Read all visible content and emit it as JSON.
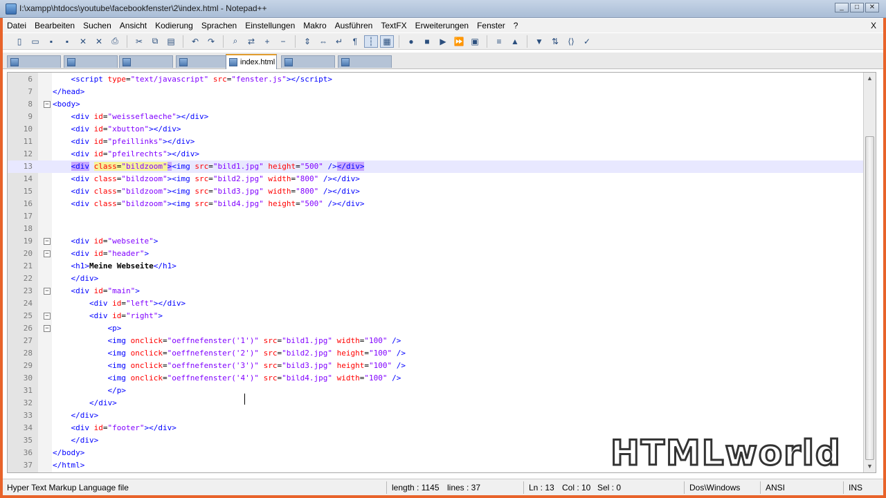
{
  "window": {
    "title": "I:\\xampp\\htdocs\\youtube\\facebookfenster\\2\\index.html - Notepad++"
  },
  "menu": [
    "Datei",
    "Bearbeiten",
    "Suchen",
    "Ansicht",
    "Kodierung",
    "Sprachen",
    "Einstellungen",
    "Makro",
    "Ausführen",
    "TextFX",
    "Erweiterungen",
    "Fenster",
    "?"
  ],
  "menu_close": "X",
  "window_controls": {
    "minimize": "_",
    "maximize": "□",
    "close": "✕"
  },
  "tabs": [
    {
      "label": "",
      "active": false
    },
    {
      "label": "",
      "active": false
    },
    {
      "label": "",
      "active": false
    },
    {
      "label": "",
      "active": false
    },
    {
      "label": "index.html",
      "active": true
    },
    {
      "label": "",
      "active": false
    },
    {
      "label": "",
      "active": false
    }
  ],
  "editor": {
    "current_line": 13,
    "lines": [
      {
        "n": "6",
        "fold": "",
        "html": "    <span class=\"tag\">&lt;script</span> <span class=\"attr\">type</span>=<span class=\"val\">\"text/javascript\"</span> <span class=\"attr\">src</span>=<span class=\"val\">\"fenster.js\"</span><span class=\"tag\">&gt;&lt;/script&gt;</span>"
      },
      {
        "n": "7",
        "fold": "",
        "html": "<span class=\"tag\">&lt;/head&gt;</span>"
      },
      {
        "n": "8",
        "fold": "−",
        "html": "<span class=\"tag\">&lt;body&gt;</span>"
      },
      {
        "n": "9",
        "fold": "",
        "html": "    <span class=\"tag\">&lt;div</span> <span class=\"attr\">id</span>=<span class=\"val\">\"weisseflaeche\"</span><span class=\"tag\">&gt;&lt;/div&gt;</span>"
      },
      {
        "n": "10",
        "fold": "",
        "html": "    <span class=\"tag\">&lt;div</span> <span class=\"attr\">id</span>=<span class=\"val\">\"xbutton\"</span><span class=\"tag\">&gt;&lt;/div&gt;</span>"
      },
      {
        "n": "11",
        "fold": "",
        "html": "    <span class=\"tag\">&lt;div</span> <span class=\"attr\">id</span>=<span class=\"val\">\"pfeillinks\"</span><span class=\"tag\">&gt;&lt;/div&gt;</span>"
      },
      {
        "n": "12",
        "fold": "",
        "html": "    <span class=\"tag\">&lt;div</span> <span class=\"attr\">id</span>=<span class=\"val\">\"pfeilrechts\"</span><span class=\"tag\">&gt;&lt;/div&gt;</span>"
      },
      {
        "n": "13",
        "fold": "",
        "html": "    <span class=\"tag hl-tag\">&lt;div</span> <span class=\"attr hl-match\">class</span><span class=\"hl-match\">=</span><span class=\"val hl-match\">\"bildzoom\"</span><span class=\"tag hl-tag\">&gt;</span><span class=\"tag\">&lt;img</span> <span class=\"attr\">src</span>=<span class=\"val\">\"bild1.jpg\"</span> <span class=\"attr\">height</span>=<span class=\"val\">\"500\"</span> <span class=\"tag\">/&gt;</span><span class=\"tag hl-tag\">&lt;/div&gt;</span>"
      },
      {
        "n": "14",
        "fold": "",
        "html": "    <span class=\"tag\">&lt;div</span> <span class=\"attr\">class</span>=<span class=\"val\">\"bildzoom\"</span><span class=\"tag\">&gt;&lt;img</span> <span class=\"attr\">src</span>=<span class=\"val\">\"bild2.jpg\"</span> <span class=\"attr\">width</span>=<span class=\"val\">\"800\"</span> <span class=\"tag\">/&gt;&lt;/div&gt;</span>"
      },
      {
        "n": "15",
        "fold": "",
        "html": "    <span class=\"tag\">&lt;div</span> <span class=\"attr\">class</span>=<span class=\"val\">\"bildzoom\"</span><span class=\"tag\">&gt;&lt;img</span> <span class=\"attr\">src</span>=<span class=\"val\">\"bild3.jpg\"</span> <span class=\"attr\">width</span>=<span class=\"val\">\"800\"</span> <span class=\"tag\">/&gt;&lt;/div&gt;</span>"
      },
      {
        "n": "16",
        "fold": "",
        "html": "    <span class=\"tag\">&lt;div</span> <span class=\"attr\">class</span>=<span class=\"val\">\"bildzoom\"</span><span class=\"tag\">&gt;&lt;img</span> <span class=\"attr\">src</span>=<span class=\"val\">\"bild4.jpg\"</span> <span class=\"attr\">height</span>=<span class=\"val\">\"500\"</span> <span class=\"tag\">/&gt;&lt;/div&gt;</span>"
      },
      {
        "n": "17",
        "fold": "",
        "html": ""
      },
      {
        "n": "18",
        "fold": "",
        "html": ""
      },
      {
        "n": "19",
        "fold": "−",
        "html": "    <span class=\"tag\">&lt;div</span> <span class=\"attr\">id</span>=<span class=\"val\">\"webseite\"</span><span class=\"tag\">&gt;</span>"
      },
      {
        "n": "20",
        "fold": "−",
        "html": "    <span class=\"tag\">&lt;div</span> <span class=\"attr\">id</span>=<span class=\"val\">\"header\"</span><span class=\"tag\">&gt;</span>"
      },
      {
        "n": "21",
        "fold": "",
        "html": "    <span class=\"tag\">&lt;h1&gt;</span><span class=\"plain\">Meine Webseite</span><span class=\"tag\">&lt;/h1&gt;</span>"
      },
      {
        "n": "22",
        "fold": "",
        "html": "    <span class=\"tag\">&lt;/div&gt;</span>"
      },
      {
        "n": "23",
        "fold": "−",
        "html": "    <span class=\"tag\">&lt;div</span> <span class=\"attr\">id</span>=<span class=\"val\">\"main\"</span><span class=\"tag\">&gt;</span>"
      },
      {
        "n": "24",
        "fold": "",
        "html": "        <span class=\"tag\">&lt;div</span> <span class=\"attr\">id</span>=<span class=\"val\">\"left\"</span><span class=\"tag\">&gt;&lt;/div&gt;</span>"
      },
      {
        "n": "25",
        "fold": "−",
        "html": "        <span class=\"tag\">&lt;div</span> <span class=\"attr\">id</span>=<span class=\"val\">\"right\"</span><span class=\"tag\">&gt;</span>"
      },
      {
        "n": "26",
        "fold": "−",
        "html": "            <span class=\"tag\">&lt;p&gt;</span>"
      },
      {
        "n": "27",
        "fold": "",
        "html": "            <span class=\"tag\">&lt;img</span> <span class=\"attr\">onclick</span>=<span class=\"val\">\"oeffnefenster('1')\"</span> <span class=\"attr\">src</span>=<span class=\"val\">\"bild1.jpg\"</span> <span class=\"attr\">width</span>=<span class=\"val\">\"100\"</span> <span class=\"tag\">/&gt;</span>"
      },
      {
        "n": "28",
        "fold": "",
        "html": "            <span class=\"tag\">&lt;img</span> <span class=\"attr\">onclick</span>=<span class=\"val\">\"oeffnefenster('2')\"</span> <span class=\"attr\">src</span>=<span class=\"val\">\"bild2.jpg\"</span> <span class=\"attr\">height</span>=<span class=\"val\">\"100\"</span> <span class=\"tag\">/&gt;</span>"
      },
      {
        "n": "29",
        "fold": "",
        "html": "            <span class=\"tag\">&lt;img</span> <span class=\"attr\">onclick</span>=<span class=\"val\">\"oeffnefenster('3')\"</span> <span class=\"attr\">src</span>=<span class=\"val\">\"bild3.jpg\"</span> <span class=\"attr\">height</span>=<span class=\"val\">\"100\"</span> <span class=\"tag\">/&gt;</span>"
      },
      {
        "n": "30",
        "fold": "",
        "html": "            <span class=\"tag\">&lt;img</span> <span class=\"attr\">onclick</span>=<span class=\"val\">\"oeffnefenster('4')\"</span> <span class=\"attr\">src</span>=<span class=\"val\">\"bild4.jpg\"</span> <span class=\"attr\">width</span>=<span class=\"val\">\"100\"</span> <span class=\"tag\">/&gt;</span>"
      },
      {
        "n": "31",
        "fold": "",
        "html": "            <span class=\"tag\">&lt;/p&gt;</span>"
      },
      {
        "n": "32",
        "fold": "",
        "html": "        <span class=\"tag\">&lt;/div&gt;</span>"
      },
      {
        "n": "33",
        "fold": "",
        "html": "    <span class=\"tag\">&lt;/div&gt;</span>"
      },
      {
        "n": "34",
        "fold": "",
        "html": "    <span class=\"tag\">&lt;div</span> <span class=\"attr\">id</span>=<span class=\"val\">\"footer\"</span><span class=\"tag\">&gt;&lt;/div&gt;</span>"
      },
      {
        "n": "35",
        "fold": "",
        "html": "    <span class=\"tag\">&lt;/div&gt;</span>"
      },
      {
        "n": "36",
        "fold": "",
        "html": "<span class=\"tag\">&lt;/body&gt;</span>"
      },
      {
        "n": "37",
        "fold": "",
        "html": "<span class=\"tag\">&lt;/html&gt;</span>"
      }
    ]
  },
  "status": {
    "file_type": "Hyper Text Markup Language file",
    "length": "length : 1145",
    "lines": "lines : 37",
    "ln": "Ln : 13",
    "col": "Col : 10",
    "sel": "Sel : 0",
    "eol": "Dos\\Windows",
    "encoding": "ANSI",
    "mode": "INS"
  },
  "watermark": "HTMLworld",
  "toolbar_icons": [
    "new-file-icon",
    "open-file-icon",
    "save-icon",
    "save-all-icon",
    "close-icon",
    "close-all-icon",
    "print-icon",
    "cut-icon",
    "copy-icon",
    "paste-icon",
    "undo-icon",
    "redo-icon",
    "find-icon",
    "replace-icon",
    "zoom-in-icon",
    "zoom-out-icon",
    "sync-v-icon",
    "sync-h-icon",
    "wrap-icon",
    "all-chars-icon",
    "indent-guide-icon",
    "udl-icon",
    "record-macro-icon",
    "stop-macro-icon",
    "play-macro-icon",
    "run-macro-multiple-icon",
    "save-macro-icon",
    "trim-icon",
    "up-icon",
    "down-icon",
    "sort-icon",
    "tag-icon",
    "spellcheck-icon"
  ]
}
